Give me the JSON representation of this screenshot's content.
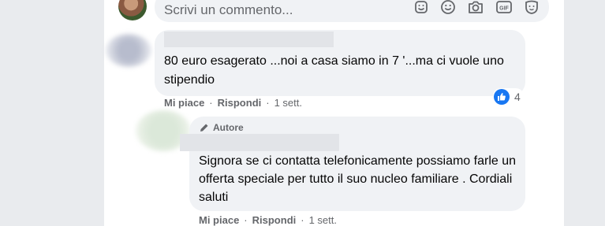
{
  "composer": {
    "placeholder": "Scrivi un commento...",
    "icons": [
      "sticker-icon",
      "emoji-icon",
      "camera-icon",
      "gif-icon",
      "avatar-sticker-icon"
    ],
    "gif_label": "GIF"
  },
  "comments": [
    {
      "text": "80 euro esagerato ...noi a casa siamo in 7 '...ma ci vuole uno stipendio",
      "reaction_count": "4",
      "like_label": "Mi piace",
      "reply_label": "Rispondi",
      "time": "1 sett.",
      "separator": "·"
    }
  ],
  "reply": {
    "badge": "Autore",
    "text": "Signora se ci contatta telefonicamente possiamo farle un offerta speciale per tutto il suo nucleo familiare . Cordiali saluti",
    "like_label": "Mi piace",
    "reply_label": "Rispondi",
    "time": "1 sett.",
    "separator": "·"
  },
  "colors": {
    "page_bg": "#e9ebee",
    "bubble": "#f0f2f5",
    "meta_text": "#65676b",
    "like_blue": "#1877f2"
  }
}
